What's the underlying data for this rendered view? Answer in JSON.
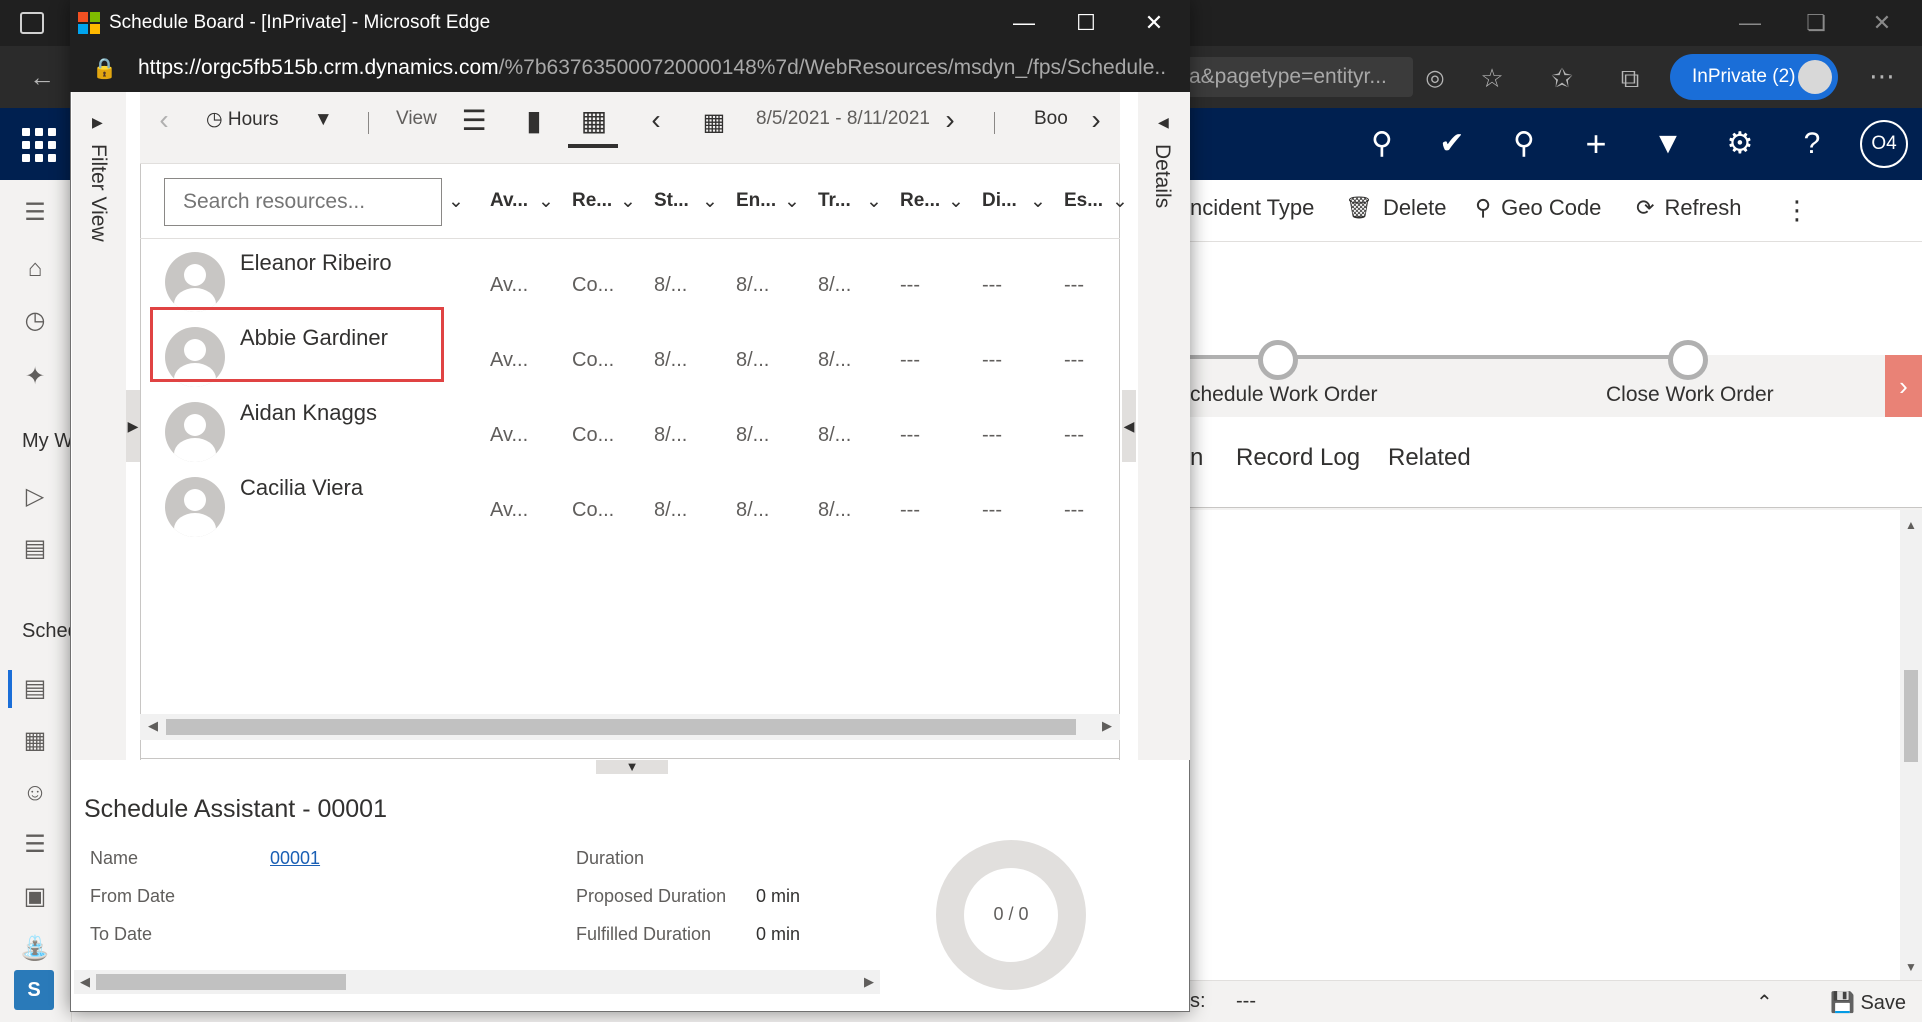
{
  "popup": {
    "title": "Schedule Board - [InPrivate] - Microsoft Edge",
    "url_host": "https://orgc5fb515b.crm.dynamics.com",
    "url_path": "/%7b637635000720000148%7d/WebResources/msdyn_/fps/Schedule..."
  },
  "background_browser": {
    "url_fragment": "a&pagetype=entityr...",
    "inprivate_label": "InPrivate (2)",
    "user_initials": "O4"
  },
  "command_bar": {
    "incident_type": "ncident Type",
    "delete": "Delete",
    "geo_code": "Geo Code",
    "refresh": "Refresh"
  },
  "process": {
    "stage_1": "chedule Work Order",
    "stage_2": "Close Work Order"
  },
  "record_tabs": {
    "partial": "n",
    "record_log": "Record Log",
    "related": "Related"
  },
  "left_rail": {
    "my_work_partial": "My W",
    "sched_partial": "Sched"
  },
  "footer": {
    "field_partial": "s:",
    "field_value": "---",
    "save": "Save",
    "avatar_letter": "S"
  },
  "schedule_board": {
    "filter_view_label": "Filter View",
    "details_label": "Details",
    "toolbar": {
      "time_scale": "Hours",
      "view_label": "View",
      "date_range": "8/5/2021 - 8/11/2021",
      "book_partial": "Boo"
    },
    "search": {
      "placeholder": "Search resources..."
    },
    "columns": [
      "Av...",
      "Re...",
      "St...",
      "En...",
      "Tr...",
      "Re...",
      "Di...",
      "Es..."
    ],
    "resources": [
      {
        "name": "Eleanor Ribeiro",
        "cells": [
          "Av...",
          "Co...",
          "8/...",
          "8/...",
          "8/...",
          "---",
          "---",
          "---"
        ]
      },
      {
        "name": "Abbie Gardiner",
        "cells": [
          "Av...",
          "Co...",
          "8/...",
          "8/...",
          "8/...",
          "---",
          "---",
          "---"
        ]
      },
      {
        "name": "Aidan Knaggs",
        "cells": [
          "Av...",
          "Co...",
          "8/...",
          "8/...",
          "8/...",
          "---",
          "---",
          "---"
        ]
      },
      {
        "name": "Cacilia Viera",
        "cells": [
          "Av...",
          "Co...",
          "8/...",
          "8/...",
          "8/...",
          "---",
          "---",
          "---"
        ]
      }
    ],
    "highlighted_resource": "Abbie Gardiner"
  },
  "schedule_assistant": {
    "title": "Schedule Assistant - 00001",
    "name_label": "Name",
    "name_value": "00001",
    "from_date_label": "From Date",
    "to_date_label": "To Date",
    "duration_label": "Duration",
    "proposed_duration_label": "Proposed Duration",
    "proposed_duration_value": "0 min",
    "fulfilled_duration_label": "Fulfilled Duration",
    "fulfilled_duration_value": "0 min",
    "donut_text": "0 / 0"
  },
  "colors": {
    "d365_nav": "#002050",
    "inprivate_badge": "#1a6ed8",
    "highlight_box": "#e04343",
    "bpf_next": "#e98276"
  }
}
